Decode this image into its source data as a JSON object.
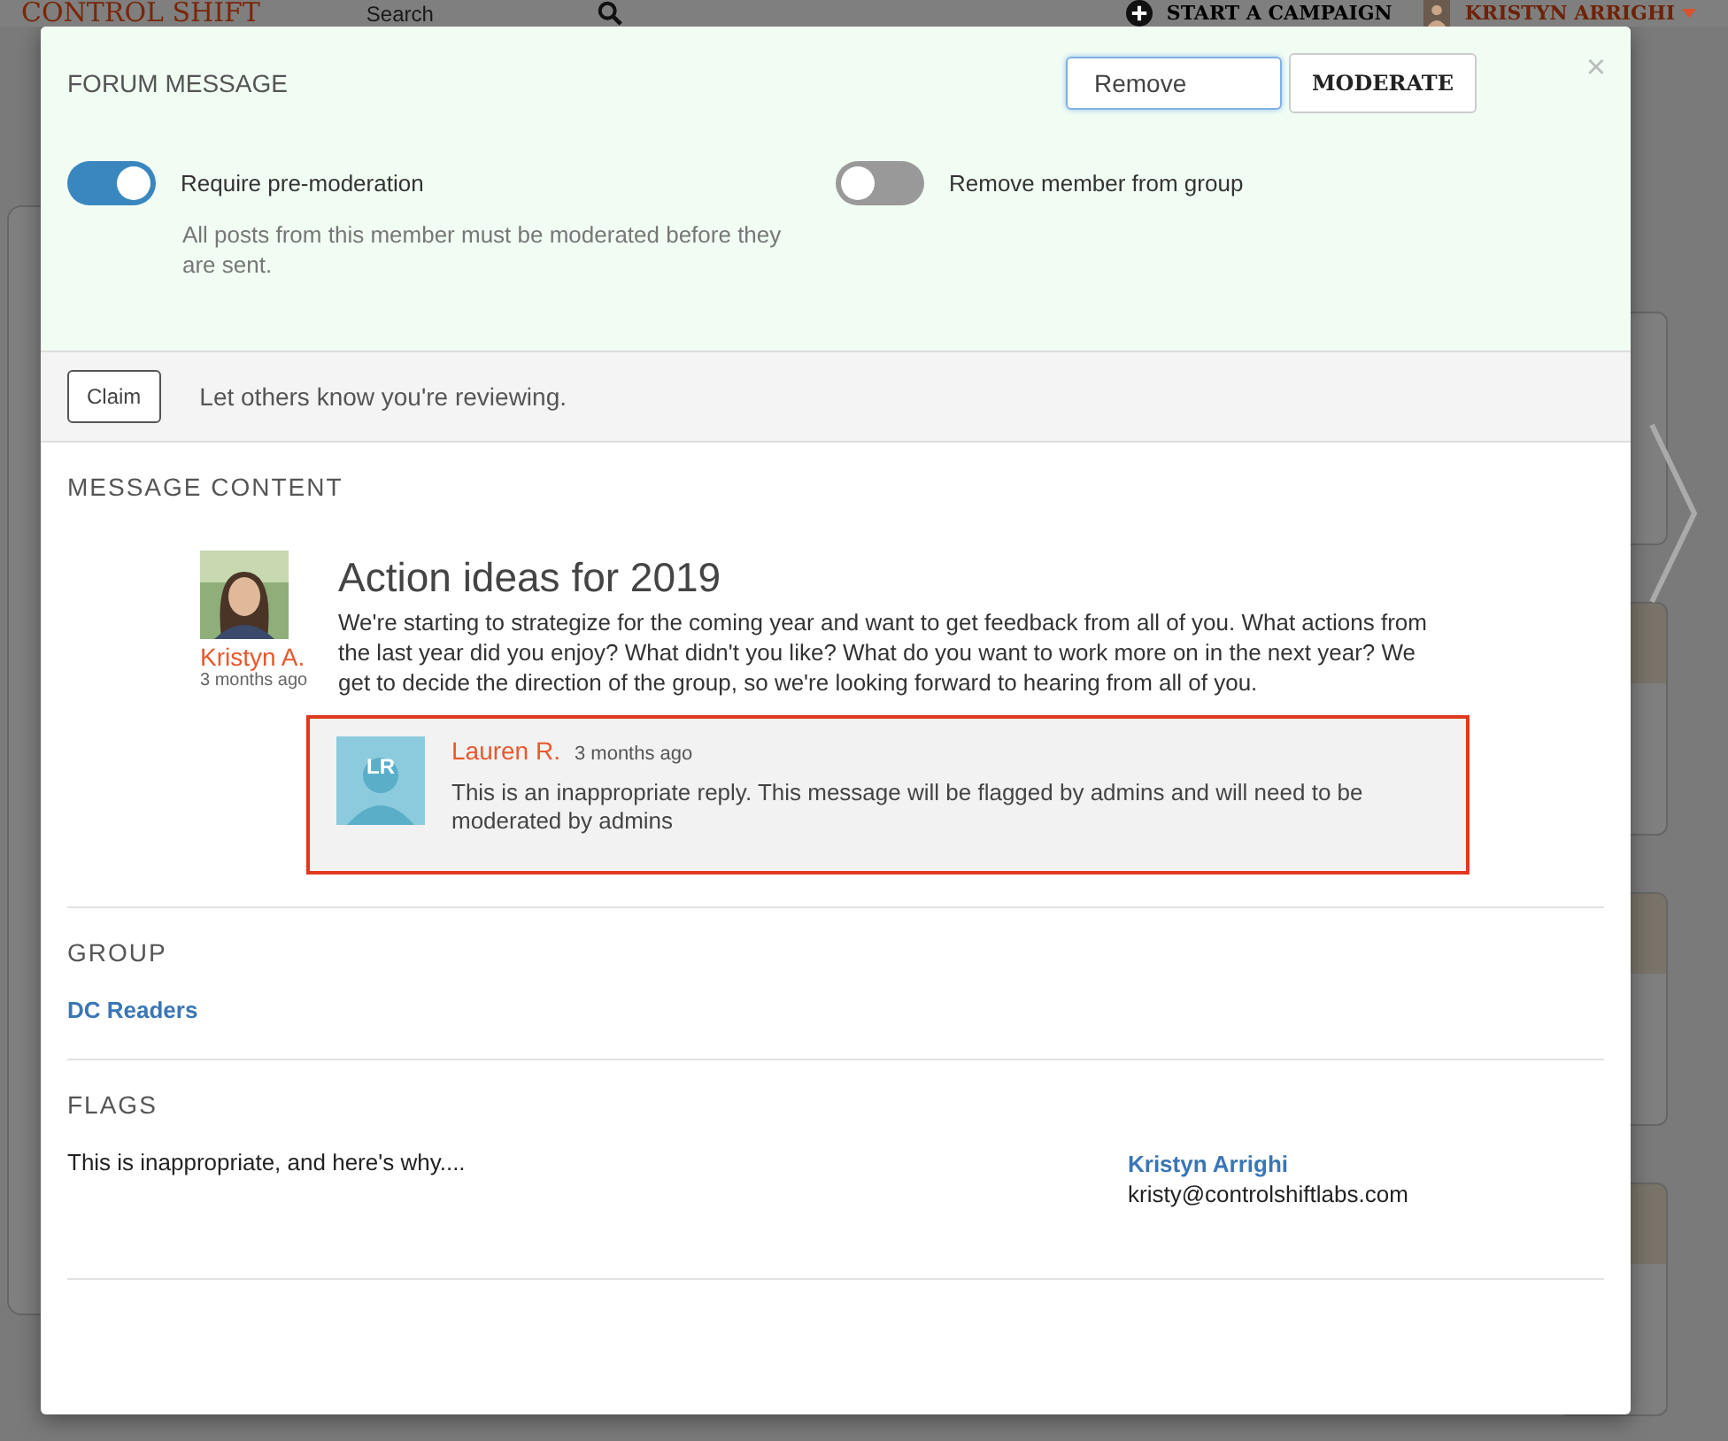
{
  "background": {
    "logo": "CONTROL SHIFT",
    "search": {
      "placeholder": "Search"
    },
    "campaign_button": "START A CAMPAIGN",
    "user_name": "KRISTYN ARRIGHI"
  },
  "modal": {
    "title": "FORUM MESSAGE",
    "action_field": {
      "value": "Remove"
    },
    "moderate_button": "MODERATE",
    "close": "×",
    "toggles": [
      {
        "label": "Require pre-moderation",
        "on": true,
        "help": "All posts from this member must be moderated before they are sent."
      },
      {
        "label": "Remove member from group",
        "on": false
      }
    ],
    "claim": {
      "button": "Claim",
      "note": "Let others know you're reviewing."
    },
    "message_content": {
      "heading": "MESSAGE CONTENT",
      "author": "Kristyn A.",
      "time": "3 months ago",
      "title": "Action ideas for 2019",
      "body": "We're starting to strategize for the coming year and want to get feedback from all of you. What actions from the last year did you enjoy? What didn't you like? What do you want to work more on in the next year? We get to decide the direction of the group, so we're looking forward to hearing from all of you.",
      "reply": {
        "initials": "LR",
        "author": "Lauren R.",
        "time": "3 months ago",
        "body": "This is an inappropriate reply. This message will be flagged by admins and will need to be moderated by admins",
        "flagged": true
      }
    },
    "group": {
      "heading": "GROUP",
      "name": "DC Readers"
    },
    "flags": {
      "heading": "FLAGS",
      "items": [
        {
          "reason": "This is inappropriate, and here's why....",
          "reporter": "Kristyn Arrighi",
          "email": "kristy@controlshiftlabs.com"
        }
      ]
    }
  }
}
